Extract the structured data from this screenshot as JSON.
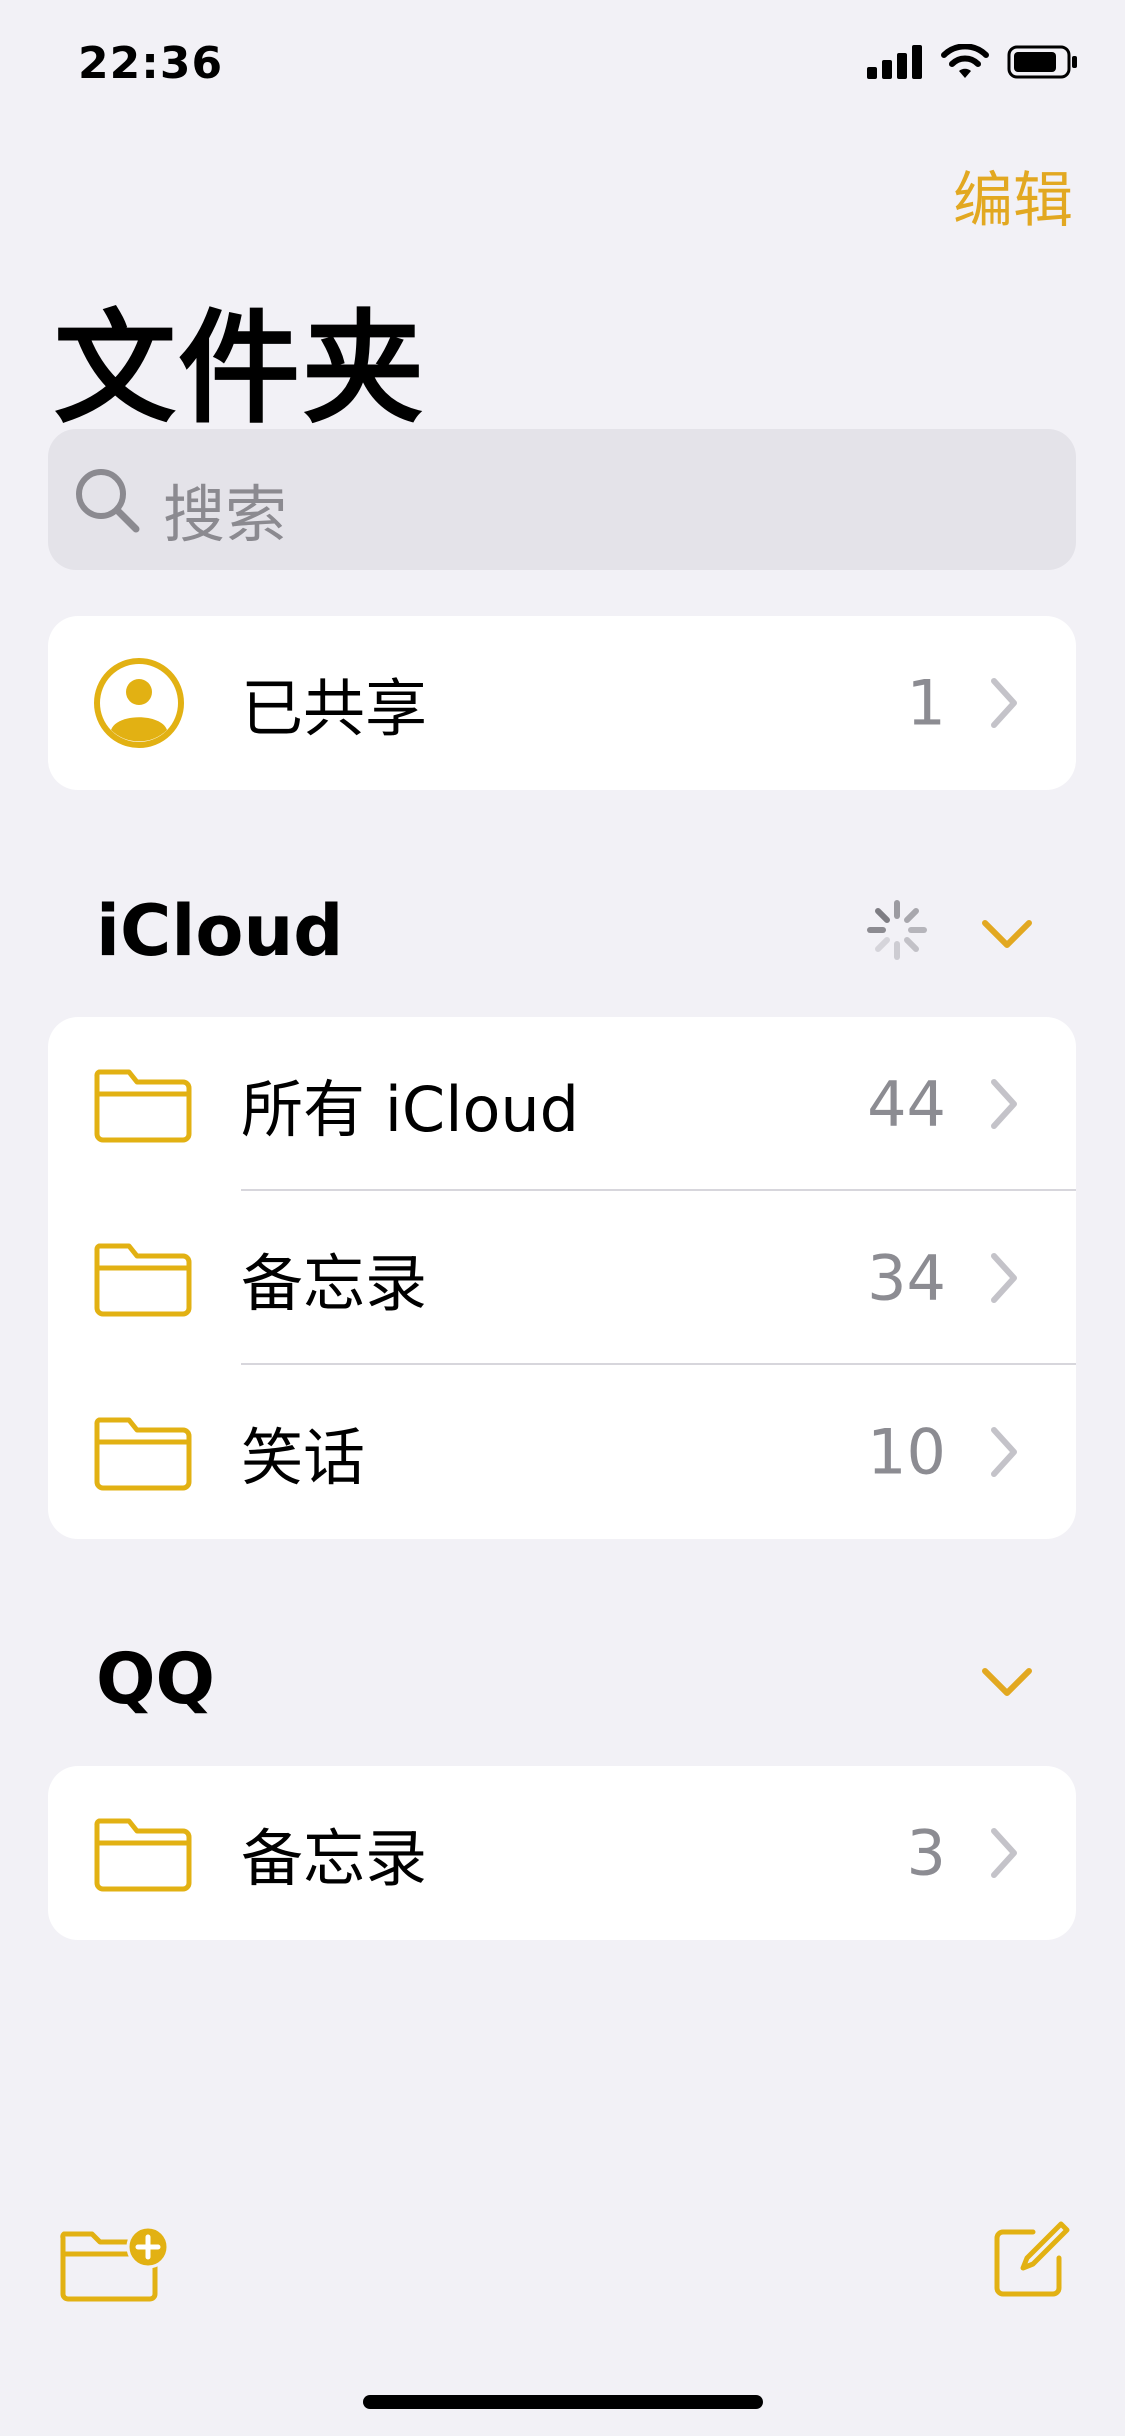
{
  "status_bar": {
    "time": "22:36"
  },
  "nav": {
    "edit_label": "编辑"
  },
  "page_title": "文件夹",
  "search": {
    "placeholder": "搜索"
  },
  "shared": {
    "label": "已共享",
    "count": "1"
  },
  "sections": [
    {
      "title": "iCloud",
      "folders": [
        {
          "label": "所有 iCloud",
          "count": "44"
        },
        {
          "label": "备忘录",
          "count": "34"
        },
        {
          "label": "笑话",
          "count": "10"
        }
      ]
    },
    {
      "title": "QQ",
      "folders": [
        {
          "label": "备忘录",
          "count": "3"
        }
      ]
    }
  ],
  "toolbar": {
    "new_folder_icon": "new-folder-icon",
    "compose_icon": "compose-icon"
  },
  "colors": {
    "accent": "#E2A821",
    "background": "#F2F1F6",
    "card": "#FFFFFF",
    "secondary_text": "#8C8C92"
  }
}
